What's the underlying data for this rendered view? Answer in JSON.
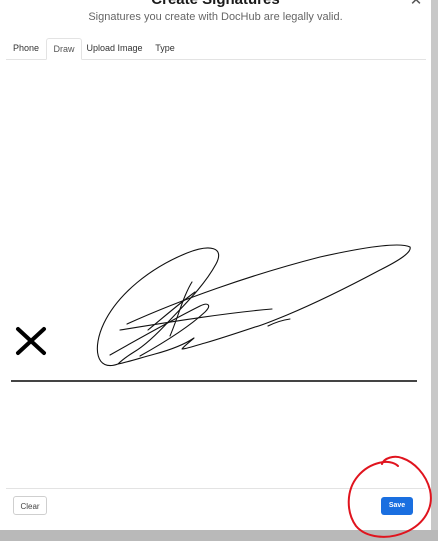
{
  "dialog": {
    "title": "Create Signatures",
    "subtitle": "Signatures you create with DocHub are legally valid.",
    "close_icon": "close-icon"
  },
  "tabs": [
    {
      "label": "Phone",
      "active": false
    },
    {
      "label": "Draw",
      "active": true
    },
    {
      "label": "Upload Image",
      "active": false
    },
    {
      "label": "Type",
      "active": false
    }
  ],
  "canvas": {
    "x_icon": "x-mark-icon",
    "ink_color": "#111111"
  },
  "footer": {
    "clear_label": "Clear",
    "save_label": "Save"
  },
  "annotation": {
    "color": "#e0141e",
    "shape": "hand-drawn circle"
  },
  "colors": {
    "save_button": "#1a6fe0",
    "signature_line": "#444444"
  }
}
